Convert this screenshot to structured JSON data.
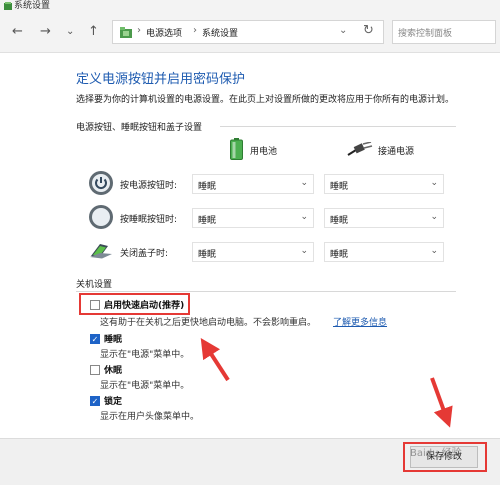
{
  "window": {
    "title": "系统设置"
  },
  "nav": {
    "back": "←",
    "forward": "→",
    "recent": "⌄",
    "up": "↑",
    "breadcrumb": [
      "电源选项",
      "系统设置"
    ],
    "crumb_sep": "›",
    "search_placeholder": "搜索控制面板"
  },
  "content": {
    "heading": "定义电源按钮并启用密码保护",
    "intro": "选择要为你的计算机设置的电源设置。在此页上对设置所做的更改将应用于你所有的电源计划。",
    "group1_title": "电源按钮、睡眠按钮和盖子设置",
    "col_battery": "用电池",
    "col_plugged": "接通电源",
    "rows": [
      {
        "label": "按电源按钮时:",
        "battery": "睡眠",
        "plugged": "睡眠"
      },
      {
        "label": "按睡眠按钮时:",
        "battery": "睡眠",
        "plugged": "睡眠"
      },
      {
        "label": "关闭盖子时:",
        "battery": "睡眠",
        "plugged": "睡眠"
      }
    ],
    "group2_title": "关机设置",
    "options": [
      {
        "label": "启用快速启动(推荐)",
        "checked": false,
        "desc": "这有助于在关机之后更快地启动电脑。不会影响重启。",
        "link": "了解更多信息"
      },
      {
        "label": "睡眠",
        "checked": true,
        "desc": "显示在\"电源\"菜单中。"
      },
      {
        "label": "休眠",
        "checked": false,
        "desc": "显示在\"电源\"菜单中。"
      },
      {
        "label": "锁定",
        "checked": true,
        "desc": "显示在用户头像菜单中。"
      }
    ]
  },
  "footer": {
    "save": "保存修改"
  },
  "watermark": "Baidu 经验",
  "colors": {
    "accent": "#1e5bb0",
    "highlight": "#e53935",
    "check": "#1e63c7"
  }
}
